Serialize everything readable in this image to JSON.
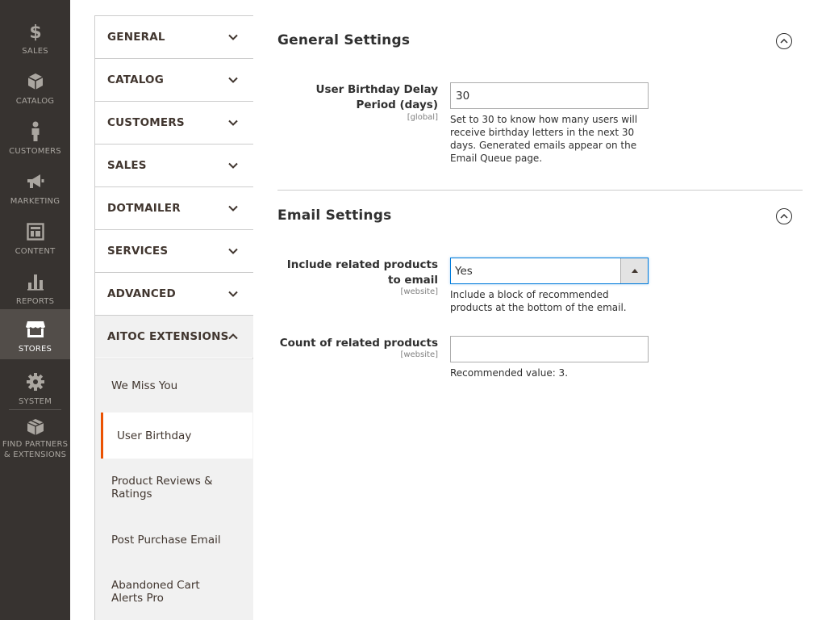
{
  "admin_menu": {
    "items": [
      {
        "label": "SALES",
        "icon": "dollar-icon"
      },
      {
        "label": "CATALOG",
        "icon": "box-icon"
      },
      {
        "label": "CUSTOMERS",
        "icon": "person-icon"
      },
      {
        "label": "MARKETING",
        "icon": "megaphone-icon"
      },
      {
        "label": "CONTENT",
        "icon": "layout-icon"
      },
      {
        "label": "REPORTS",
        "icon": "bar-chart-icon"
      },
      {
        "label": "STORES",
        "icon": "storefront-icon"
      },
      {
        "label": "SYSTEM",
        "icon": "gear-icon"
      },
      {
        "label": "FIND PARTNERS & EXTENSIONS",
        "icon": "cubes-icon"
      }
    ],
    "active": "STORES"
  },
  "config_nav": {
    "sections": [
      {
        "label": "GENERAL"
      },
      {
        "label": "CATALOG"
      },
      {
        "label": "CUSTOMERS"
      },
      {
        "label": "SALES"
      },
      {
        "label": "DOTMAILER"
      },
      {
        "label": "SERVICES"
      },
      {
        "label": "ADVANCED"
      },
      {
        "label": "AITOC EXTENSIONS"
      }
    ],
    "sub_items": [
      {
        "label": "We Miss You"
      },
      {
        "label": "User Birthday"
      },
      {
        "label": "Product Reviews & Ratings"
      },
      {
        "label": "Post Purchase Email"
      },
      {
        "label": "Abandoned Cart Alerts Pro"
      }
    ],
    "active_sub_item": "User Birthday"
  },
  "general_settings": {
    "title": "General Settings",
    "delay_field": {
      "label": "User Birthday Delay Period (days)",
      "scope": "[global]",
      "value": "30",
      "note": "Set to 30 to know how many users will receive birthday letters in the next 30 days. Generated emails appear on the Email Queue page."
    }
  },
  "email_settings": {
    "title": "Email Settings",
    "related_field": {
      "label": "Include related products to email",
      "scope": "[website]",
      "value": "Yes",
      "note": "Include a block of recommended products at the bottom of the email."
    },
    "count_field": {
      "label": "Count of related products",
      "scope": "[website]",
      "value": "",
      "note": "Recommended value: 3."
    }
  },
  "colors": {
    "menu_bg": "#373330",
    "menu_active_bg": "#524d49",
    "active_accent": "#eb5202",
    "focus_border": "#007bdb"
  }
}
